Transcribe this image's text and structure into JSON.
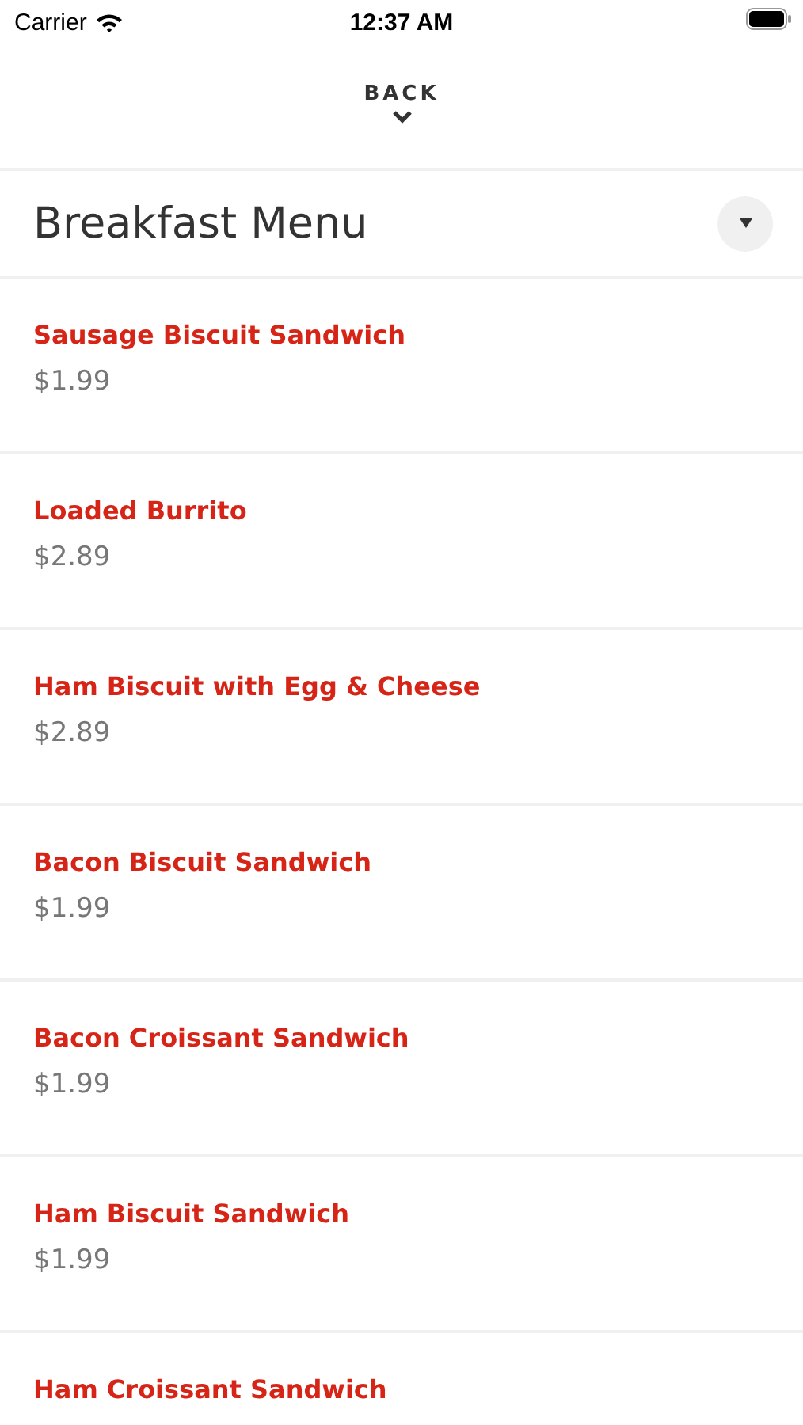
{
  "status_bar": {
    "carrier": "Carrier",
    "time": "12:37 AM"
  },
  "back": {
    "label": "BACK"
  },
  "title": "Breakfast Menu",
  "items": [
    {
      "name": "Sausage Biscuit Sandwich",
      "price": "$1.99"
    },
    {
      "name": "Loaded Burrito",
      "price": "$2.89"
    },
    {
      "name": "Ham Biscuit with Egg & Cheese",
      "price": "$2.89"
    },
    {
      "name": "Bacon Biscuit Sandwich",
      "price": "$1.99"
    },
    {
      "name": "Bacon Croissant Sandwich",
      "price": "$1.99"
    },
    {
      "name": "Ham Biscuit Sandwich",
      "price": "$1.99"
    },
    {
      "name": "Ham Croissant Sandwich"
    }
  ]
}
